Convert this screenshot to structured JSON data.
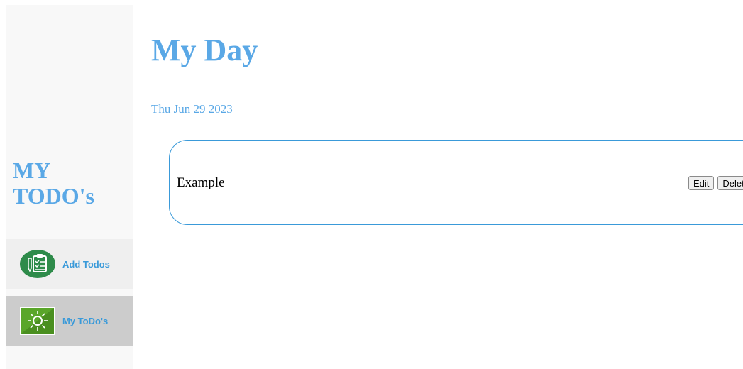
{
  "sidebar": {
    "title": "MY TODO's",
    "items": [
      {
        "label": "Add Todos",
        "icon": "clipboard-checklist-icon"
      },
      {
        "label": "My ToDo's",
        "icon": "sun-icon"
      }
    ]
  },
  "main": {
    "title": "My Day",
    "date": "Thu Jun 29 2023",
    "todos": [
      {
        "text": "Example",
        "edit_label": "Edit",
        "delete_label": "Delete"
      }
    ]
  },
  "colors": {
    "accent": "#5aa8e6",
    "link": "#3a9ad9",
    "sidebar_bg": "#f8f8f8",
    "active_item_bg": "#cccccc"
  }
}
